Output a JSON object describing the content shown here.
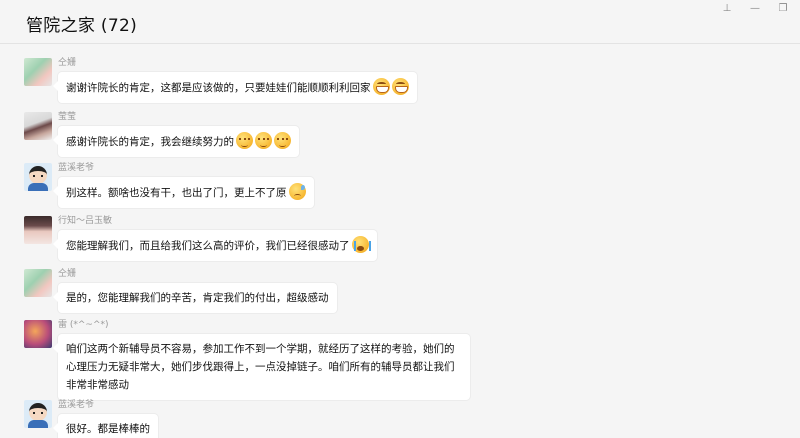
{
  "window": {
    "title": "管院之家 (72)",
    "pin_icon": "pin-icon",
    "minimize_icon": "minimize-icon",
    "restore_icon": "restore-icon"
  },
  "messages": [
    {
      "sender": "仝姗",
      "text": "谢谢许院长的肯定，这都是应该做的，只要娃娃们能顺顺利利回家",
      "emojis": [
        "grin",
        "grin"
      ]
    },
    {
      "sender": "莹莹",
      "text": "感谢许院长的肯定，我会继续努力的",
      "emojis": [
        "sleepy",
        "sleepy",
        "sleepy"
      ]
    },
    {
      "sender": "蓝溪老爷",
      "text": "别这样。额啥也没有干，也出了门，更上不了原",
      "emojis": [
        "pout"
      ]
    },
    {
      "sender": "行知～吕玉敏",
      "text": "您能理解我们，而且给我们这么高的评价，我们已经很感动了",
      "emojis": [
        "cry"
      ]
    },
    {
      "sender": "仝姗",
      "text": "是的，您能理解我们的辛苦，肯定我们的付出，超级感动",
      "emojis": []
    },
    {
      "sender": "雷 (*^~^*)",
      "text": "咱们这两个新辅导员不容易，参加工作不到一个学期，就经历了这样的考验，她们的心理压力无疑非常大，她们步伐跟得上，一点没掉链子。咱们所有的辅导员都让我们非常非常感动",
      "emojis": []
    },
    {
      "sender": "蓝溪老爷",
      "text": "很好。都是棒棒的",
      "emojis": []
    }
  ]
}
